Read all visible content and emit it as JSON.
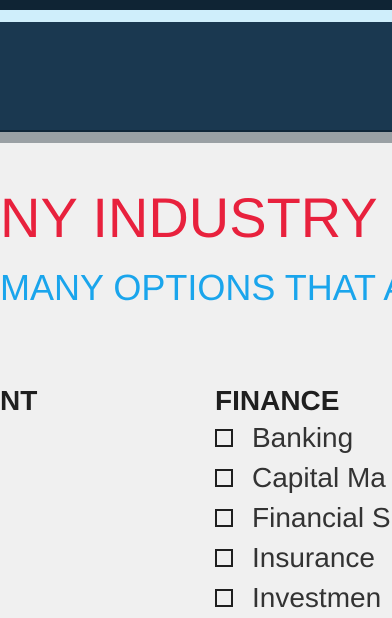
{
  "banner": {
    "headline": "NY INDUSTRY",
    "subheadline": "MANY OPTIONS THAT A"
  },
  "columns": {
    "left": {
      "title": "NT"
    },
    "right": {
      "title": "FINANCE",
      "options": [
        "Banking",
        "Capital Ma",
        "Financial S",
        "Insurance",
        "Investmen"
      ]
    }
  },
  "colors": {
    "headline": "#e8213d",
    "subheadline": "#1aa5ec",
    "header_panel": "#1a3850",
    "header_band": "#cfeefb"
  }
}
